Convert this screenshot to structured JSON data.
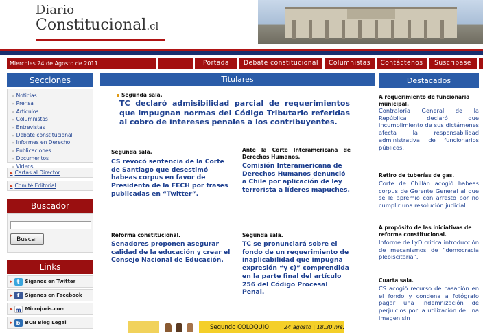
{
  "site": {
    "logo_top": "Diario",
    "logo_main": "Constitucional",
    "logo_suffix": ".cl"
  },
  "nav": {
    "date": "Miercoles 24 de Agosto de 2011",
    "items": [
      "Portada",
      "Debate constitucional",
      "Columnistas",
      "Contáctenos",
      "Suscribase"
    ]
  },
  "secciones": {
    "title": "Secciones",
    "items": [
      "Noticias",
      "Prensa",
      "Artículos",
      "Columnistas",
      "Entrevistas",
      "Debate constitucional",
      "Informes en Derecho",
      "Publicaciones",
      "Documentos",
      "Videos"
    ],
    "cartas": "Cartas al Director",
    "comite": "Comité Editorial"
  },
  "buscador": {
    "title": "Buscador",
    "button": "Buscar",
    "value": ""
  },
  "links": {
    "title": "Links",
    "items": [
      "Síganos en Twitter",
      "Síganos en Facebook",
      "Microjuris.com",
      "BCN Blog Legal"
    ]
  },
  "titulares": {
    "title": "Titulares",
    "lead": {
      "kicker": "Segunda sala.",
      "headline": "TC declaró admisibilidad parcial de requerimientos que impugnan normas del Código Tributario referidas al cobro de intereses penales a los contribuyentes."
    },
    "articles": [
      {
        "kicker": "Segunda sala.",
        "headline": "CS revocó sentencia de la Corte de Santiago que desestimó habeas corpus en favor de Presidenta de la FECH por frases publicadas en “Twitter”."
      },
      {
        "kicker": "Ante la Corte Interamericana de Derechos Humanos.",
        "headline": "Comisión Interamericana de Derechos Humanos denunció a Chile por aplicación de ley terrorista a líderes mapuches."
      },
      {
        "kicker": "Reforma constitucional.",
        "headline": "Senadores proponen asegurar calidad de la educación y crear el Consejo Nacional de Educación."
      },
      {
        "kicker": "Segunda sala.",
        "headline": "TC se pronunciará sobre el fondo de un requerimiento de inaplicabilidad que impugna expresión “y c)” comprendida en la parte final del artículo 256 del Código Procesal Penal."
      }
    ]
  },
  "banner": {
    "text1": "Segundo COLOQUIO",
    "text2": "24 agosto | 18.30 hrs."
  },
  "destacados": {
    "title": "Destacados",
    "items": [
      {
        "kicker": "A requerimiento de funcionaria municipal.",
        "body": "Contraloría General de la República declaró que incumplimiento de sus dictámenes afecta la responsabilidad administrativa de funcionarios públicos."
      },
      {
        "kicker": "Retiro de tuberías de gas.",
        "body": "Corte de Chillán acogió habeas corpus de Gerente General al que se le apremio con arresto por no cumplir una resolución judicial."
      },
      {
        "kicker": "A propósito de las iniciativas de reforma constitucional.",
        "body": "Informe de LyD critica introducción de mecanismos de “democracia plebiscitaria”."
      },
      {
        "kicker": "Cuarta sala.",
        "body": "CS acogió recurso de casación en el fondo y condena a fotógrafo pagar una indemnización de perjuicios por la utilización de una imagen sin"
      }
    ]
  }
}
